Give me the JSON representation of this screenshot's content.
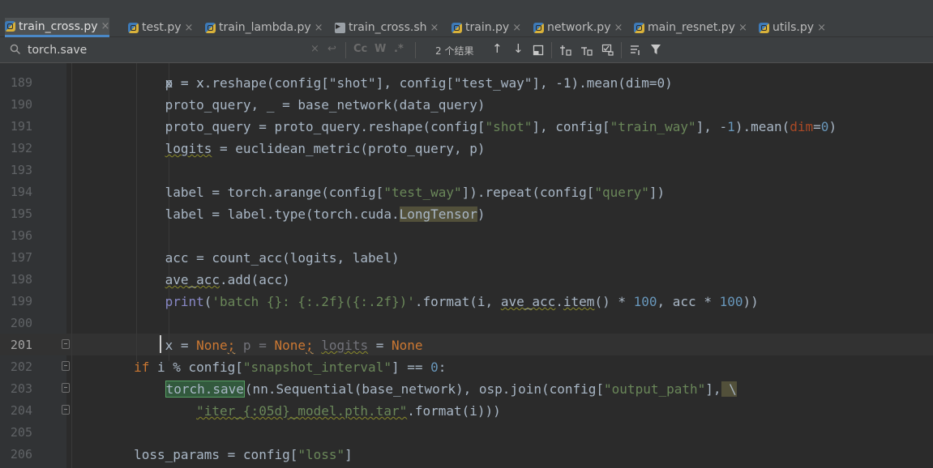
{
  "tabs": [
    {
      "label": "train_cross.py",
      "type": "py",
      "active": true
    },
    {
      "label": "test.py",
      "type": "py",
      "active": false
    },
    {
      "label": "train_lambda.py",
      "type": "py",
      "active": false
    },
    {
      "label": "train_cross.sh",
      "type": "sh",
      "active": false
    },
    {
      "label": "train.py",
      "type": "py",
      "active": false
    },
    {
      "label": "network.py",
      "type": "py",
      "active": false
    },
    {
      "label": "main_resnet.py",
      "type": "py",
      "active": false
    },
    {
      "label": "utils.py",
      "type": "py",
      "active": false
    }
  ],
  "search": {
    "query": "torch.save",
    "match_case_label": "Cc",
    "words_label": "W",
    "regex_label": ".*",
    "match_count": "2 个结果"
  },
  "code_lines": [
    {
      "num": "189",
      "segments": [
        {
          "t": "            p = x",
          "c": ""
        }
      ]
    },
    {
      "num": "190",
      "segments": [
        {
          "t": "            proto_query, _ = base_network(data_query)",
          "c": ""
        }
      ]
    },
    {
      "num": "191",
      "segments": [
        {
          "t": "            proto_query = proto_query.reshape(config[",
          "c": ""
        },
        {
          "t": "\"shot\"",
          "c": "str"
        },
        {
          "t": "], config[",
          "c": ""
        },
        {
          "t": "\"train_way\"",
          "c": "str"
        },
        {
          "t": "], -",
          "c": ""
        },
        {
          "t": "1",
          "c": "num"
        },
        {
          "t": ").mean(",
          "c": ""
        },
        {
          "t": "dim",
          "c": "param"
        },
        {
          "t": "=",
          "c": ""
        },
        {
          "t": "0",
          "c": "num"
        },
        {
          "t": ")",
          "c": ""
        }
      ]
    },
    {
      "num": "192",
      "segments": [
        {
          "t": "            ",
          "c": ""
        },
        {
          "t": "logits",
          "c": "typo"
        },
        {
          "t": " = euclidean_metric(proto_query, p)",
          "c": ""
        }
      ]
    },
    {
      "num": "193",
      "segments": []
    },
    {
      "num": "194",
      "segments": [
        {
          "t": "            label = torch.arange(config[",
          "c": ""
        },
        {
          "t": "\"test_way\"",
          "c": "str"
        },
        {
          "t": "]).repeat(config[",
          "c": ""
        },
        {
          "t": "\"query\"",
          "c": "str"
        },
        {
          "t": "])",
          "c": ""
        }
      ]
    },
    {
      "num": "195",
      "segments": [
        {
          "t": "            label = label.type(torch.cuda.",
          "c": ""
        },
        {
          "t": "LongTensor",
          "c": "hl-use"
        },
        {
          "t": ")",
          "c": ""
        }
      ]
    },
    {
      "num": "196",
      "segments": []
    },
    {
      "num": "197",
      "segments": [
        {
          "t": "            acc = count_acc(logits, label)",
          "c": ""
        }
      ]
    },
    {
      "num": "198",
      "segments": [
        {
          "t": "            ",
          "c": ""
        },
        {
          "t": "ave_acc",
          "c": "typo"
        },
        {
          "t": ".add(acc)",
          "c": ""
        }
      ]
    },
    {
      "num": "199",
      "segments": [
        {
          "t": "            ",
          "c": ""
        },
        {
          "t": "print",
          "c": "builtin"
        },
        {
          "t": "(",
          "c": ""
        },
        {
          "t": "'batch {}: {:.2f}({:.2f})'",
          "c": "str"
        },
        {
          "t": ".format(i, ",
          "c": ""
        },
        {
          "t": "ave_acc",
          "c": "typo"
        },
        {
          "t": ".",
          "c": ""
        },
        {
          "t": "item",
          "c": "typo"
        },
        {
          "t": "() * ",
          "c": ""
        },
        {
          "t": "100",
          "c": "num"
        },
        {
          "t": ", acc * ",
          "c": ""
        },
        {
          "t": "100",
          "c": "num"
        },
        {
          "t": "))",
          "c": ""
        }
      ]
    },
    {
      "num": "200",
      "segments": []
    },
    {
      "num": "201",
      "segments": [
        {
          "t": "            x = ",
          "c": ""
        },
        {
          "t": "None",
          "c": "kw"
        },
        {
          "t": ";",
          "c": "kw warn"
        },
        {
          "t": " p = ",
          "c": "unused"
        },
        {
          "t": "None",
          "c": "kw"
        },
        {
          "t": ";",
          "c": "kw warn"
        },
        {
          "t": " ",
          "c": ""
        },
        {
          "t": "logits",
          "c": "unused typo"
        },
        {
          "t": " = ",
          "c": ""
        },
        {
          "t": "None",
          "c": "kw"
        }
      ]
    },
    {
      "num": "202",
      "segments": [
        {
          "t": "        ",
          "c": ""
        },
        {
          "t": "if",
          "c": "kw"
        },
        {
          "t": " i % config[",
          "c": ""
        },
        {
          "t": "\"snapshot_interval\"",
          "c": "str"
        },
        {
          "t": "] == ",
          "c": ""
        },
        {
          "t": "0",
          "c": "num"
        },
        {
          "t": ":",
          "c": ""
        }
      ]
    },
    {
      "num": "203",
      "segments": [
        {
          "t": "            ",
          "c": ""
        },
        {
          "t": "torch.save",
          "c": "hl-match"
        },
        {
          "t": "(nn.Sequential(base_network), osp.join(config[",
          "c": ""
        },
        {
          "t": "\"output_path\"",
          "c": "str"
        },
        {
          "t": "],",
          "c": ""
        },
        {
          "t": " \\",
          "c": "hl-use"
        }
      ]
    },
    {
      "num": "204",
      "segments": [
        {
          "t": "                ",
          "c": ""
        },
        {
          "t": "\"iter_{:05d}_model.pth.tar\"",
          "c": "str typo"
        },
        {
          "t": ".format(i)))",
          "c": ""
        }
      ]
    },
    {
      "num": "205",
      "segments": []
    },
    {
      "num": "206",
      "segments": [
        {
          "t": "        loss_params = config[",
          "c": ""
        },
        {
          "t": "\"loss\"",
          "c": "str"
        },
        {
          "t": "]",
          "c": ""
        }
      ]
    }
  ],
  "partial_top_line": "            x = x.reshape(config[\"shot\"], config[\"test_way\"], -1).mean(dim=0)",
  "current_line": "201"
}
